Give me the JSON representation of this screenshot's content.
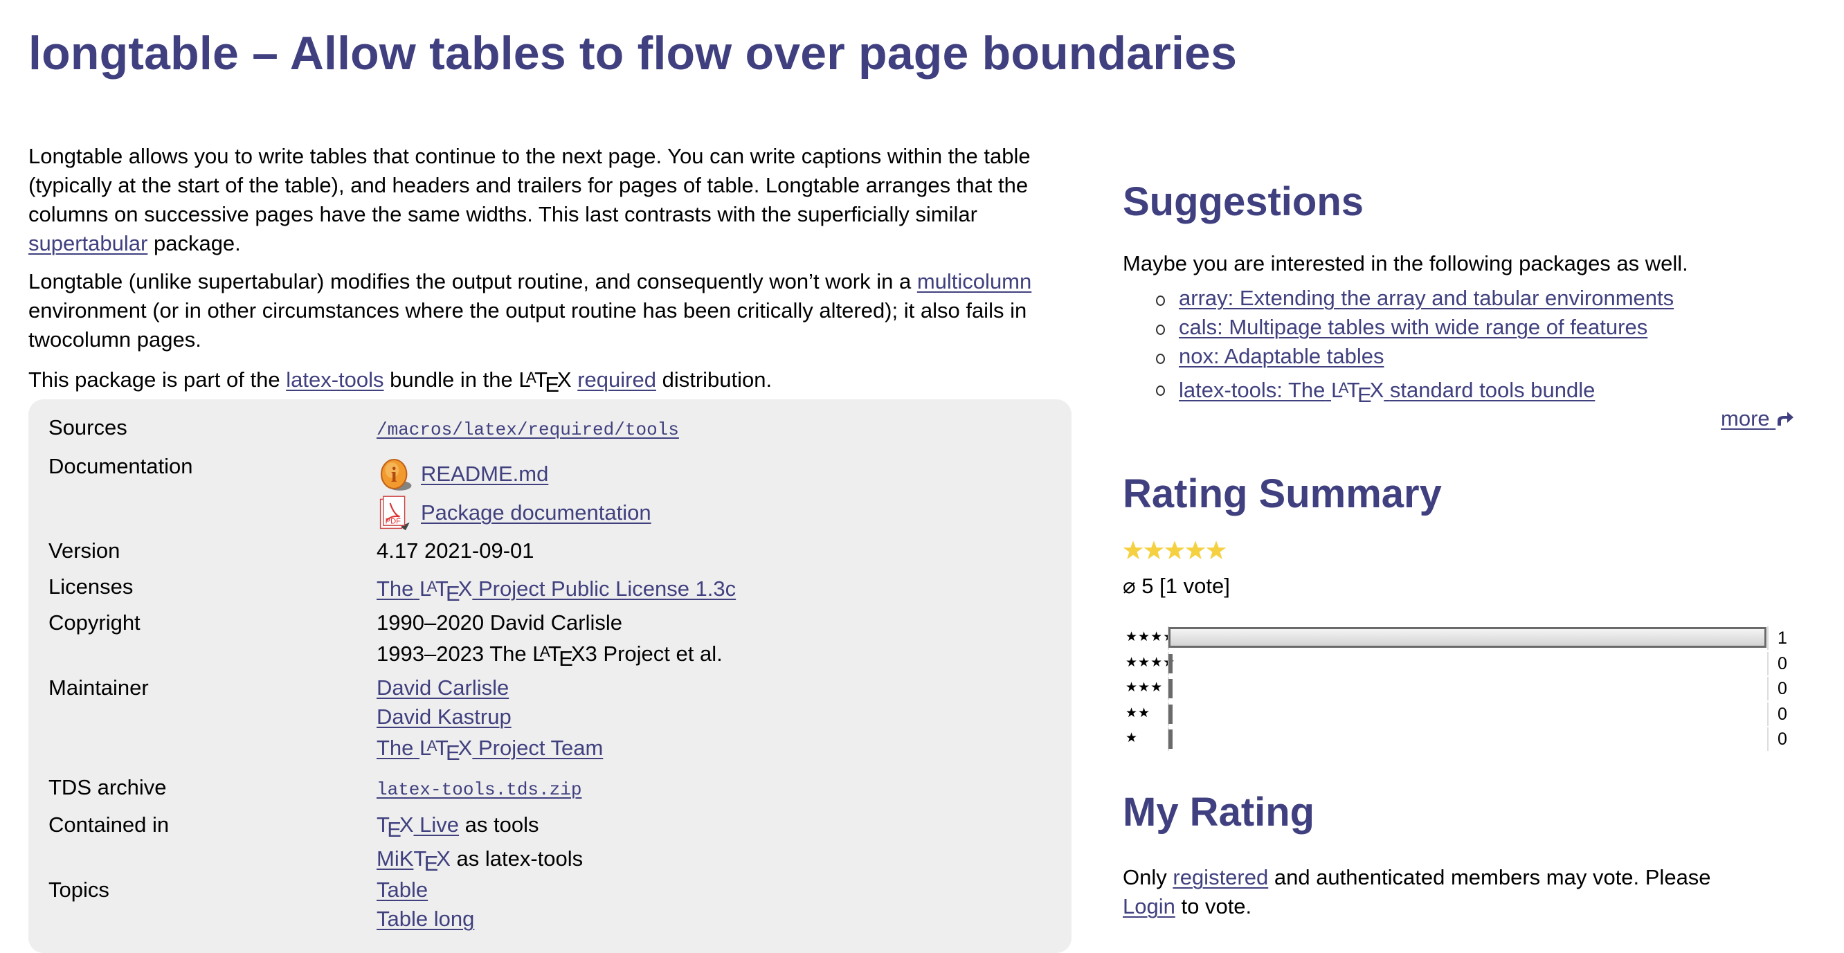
{
  "page": {
    "title": "longtable – Allow tables to flow over page boundaries"
  },
  "description": {
    "p1_text": "Longtable allows you to write tables that continue to the next page. You can write captions within the table (typically at the start of the table), and headers and trailers for pages of table. Longtable arranges that the columns on successive pages have the same widths. This last contrasts with the superficially similar",
    "p1_link": "supertabular",
    "p1_tail": "package.",
    "p2_text": "Longtable (unlike supertabular) modifies the output routine, and consequently won’t work in a",
    "p2_link": "multicolumn",
    "p2_tail": "environment (or in other circumstances where the output routine has been critically altered); it also fails in twocolumn pages.",
    "p3_pre": "This package is part of the",
    "p3_link1": "latex-tools",
    "p3_mid": "bundle in the",
    "p3_link2": "required",
    "p3_tail": "distribution."
  },
  "latex_logo": {
    "L": "L",
    "A": "A",
    "T": "T",
    "E": "E",
    "X": "X"
  },
  "info": {
    "sources": {
      "label": "Sources",
      "value": "/macros/latex/required/tools"
    },
    "documentation": {
      "label": "Documentation",
      "items": [
        {
          "label": "README.md",
          "icon": "info-icon"
        },
        {
          "label": "Package documentation",
          "icon": "pdf-icon"
        }
      ]
    },
    "version": {
      "label": "Version",
      "value": "4.17 2021-09-01"
    },
    "licenses": {
      "label": "Licenses",
      "pre": "The",
      "post": "Project Public License 1.3c"
    },
    "copyright": {
      "label": "Copyright",
      "line1": "1990–2020 David Carlisle",
      "line2_pre": "1993–2023 The",
      "line2_post": "3 Project et al."
    },
    "maintainer": {
      "label": "Maintainer",
      "items": [
        "David Carlisle",
        "David Kastrup"
      ],
      "team_pre": "The",
      "team_post": "Project Team"
    },
    "tds": {
      "label": "TDS archive",
      "value": "latex-tools.tds.zip"
    },
    "contained": {
      "label": "Contained in",
      "texlive_suffix": "Live",
      "texlive_note": "as tools",
      "miktex_prefix": "MiK",
      "miktex_note": "as latex-tools"
    },
    "topics": {
      "label": "Topics",
      "items": [
        "Table",
        "Table long"
      ]
    }
  },
  "suggestions": {
    "heading": "Suggestions",
    "intro": "Maybe you are interested in the following packages as well.",
    "items": [
      "array: Extending the array and tabular environments",
      "cals: Multipage tables with wide range of features",
      "nox: Adaptable tables"
    ],
    "latex_item_pre": "latex-tools: The",
    "latex_item_post": "standard tools bundle",
    "more_label": "more"
  },
  "rating_summary": {
    "heading": "Rating Summary",
    "average": 5,
    "average_text": "⌀ 5 [1 vote]",
    "stars_filled": 5,
    "histogram": [
      {
        "label": "★★★★★",
        "count": 1,
        "fraction": 1.0
      },
      {
        "label": "★★★★",
        "count": 0,
        "fraction": 0
      },
      {
        "label": "★★★",
        "count": 0,
        "fraction": 0
      },
      {
        "label": "★★",
        "count": 0,
        "fraction": 0
      },
      {
        "label": "★",
        "count": 0,
        "fraction": 0
      }
    ],
    "star_color": "#f5d142"
  },
  "my_rating": {
    "heading": "My Rating",
    "pre": "Only",
    "link_registered": "registered",
    "mid": "and authenticated members may vote. Please",
    "link_login": "Login",
    "tail": "to vote."
  },
  "colors": {
    "accent": "#404080",
    "box_bg": "#eeeeee"
  }
}
